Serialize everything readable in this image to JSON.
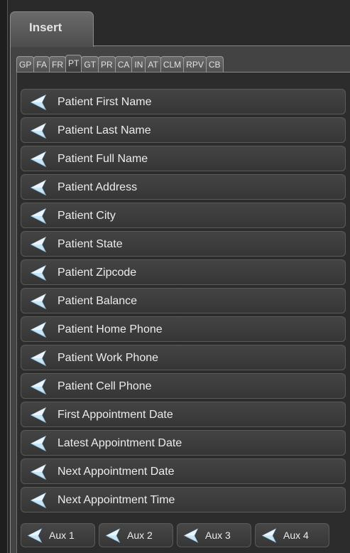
{
  "main_tab": {
    "label": "Insert"
  },
  "subtabs": [
    {
      "label": "GP"
    },
    {
      "label": "FA"
    },
    {
      "label": "FR"
    },
    {
      "label": "PT",
      "active": true
    },
    {
      "label": "GT"
    },
    {
      "label": "PR"
    },
    {
      "label": "CA"
    },
    {
      "label": "IN"
    },
    {
      "label": "AT"
    },
    {
      "label": "CLM"
    },
    {
      "label": "RPV"
    },
    {
      "label": "CB"
    }
  ],
  "fields": [
    {
      "label": "Patient First Name"
    },
    {
      "label": "Patient Last Name"
    },
    {
      "label": "Patient Full Name"
    },
    {
      "label": "Patient Address"
    },
    {
      "label": "Patient City"
    },
    {
      "label": "Patient State"
    },
    {
      "label": "Patient Zipcode"
    },
    {
      "label": "Patient Balance"
    },
    {
      "label": "Patient Home Phone"
    },
    {
      "label": "Patient Work Phone"
    },
    {
      "label": "Patient Cell Phone"
    },
    {
      "label": "First Appointment Date"
    },
    {
      "label": "Latest Appointment Date"
    },
    {
      "label": "Next Appointment Date"
    },
    {
      "label": "Next Appointment Time"
    }
  ],
  "aux_buttons": [
    {
      "label": "Aux 1"
    },
    {
      "label": "Aux 2"
    },
    {
      "label": "Aux 3"
    },
    {
      "label": "Aux 4"
    }
  ],
  "icon": "insert-arrow-icon"
}
